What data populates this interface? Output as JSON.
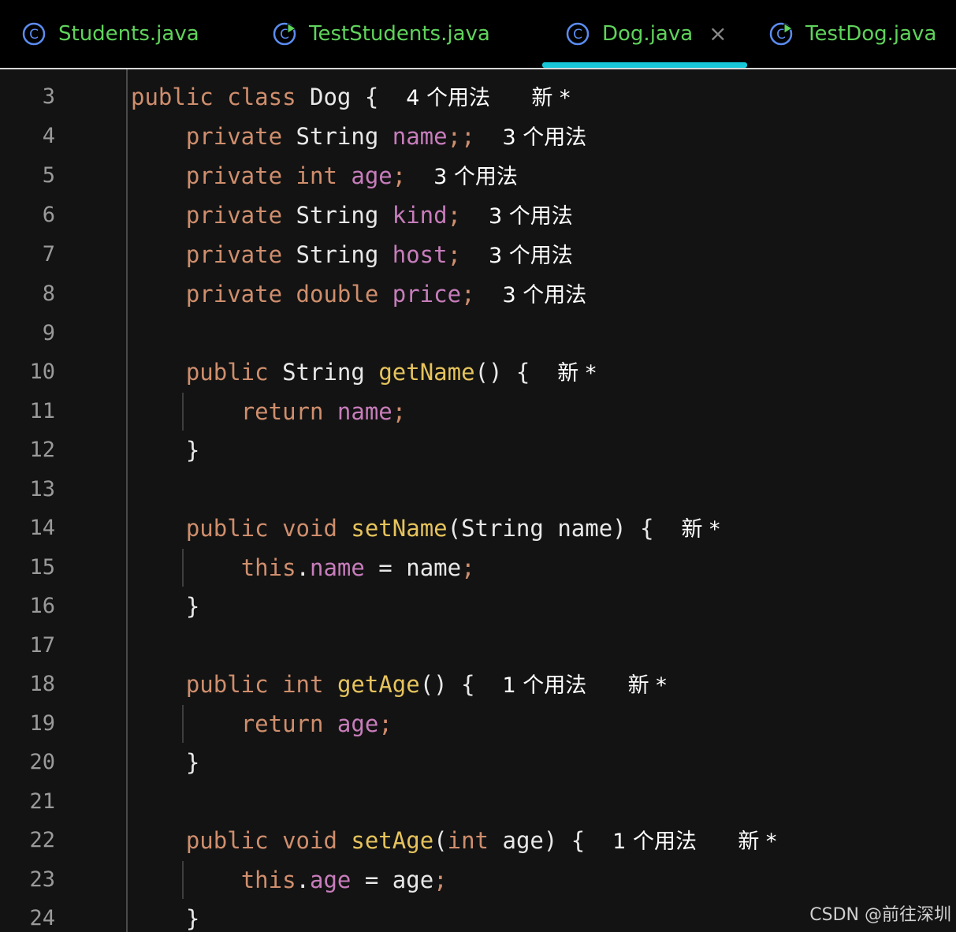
{
  "tabs": [
    {
      "label": "Students.java",
      "icon": "class-icon",
      "active": false
    },
    {
      "label": "TestStudents.java",
      "icon": "runnable-class-icon",
      "active": false
    },
    {
      "label": "Dog.java",
      "icon": "class-icon",
      "active": true,
      "close": "×"
    },
    {
      "label": "TestDog.java",
      "icon": "runnable-class-icon",
      "active": false
    }
  ],
  "colors": {
    "keyword": "#cf8e6d",
    "field": "#c77dbb",
    "method": "#e6c35c",
    "tab_text": "#5fd35b",
    "active_tab_underline": "#17c7d8"
  },
  "editor": {
    "line_numbers": [
      "3",
      "4",
      "5",
      "6",
      "7",
      "8",
      "9",
      "10",
      "11",
      "12",
      "13",
      "14",
      "15",
      "16",
      "17",
      "18",
      "19",
      "20",
      "21",
      "22",
      "23",
      "24"
    ],
    "tokens": {
      "public": "public",
      "private": "private",
      "class": "class",
      "int": "int",
      "double": "double",
      "void": "void",
      "return": "return",
      "this": "this",
      "String": "String",
      "Dog": "Dog",
      "name": "name",
      "age": "age",
      "kind": "kind",
      "host": "host",
      "price": "price",
      "getName": "getName",
      "setName": "setName",
      "getAge": "getAge",
      "setAge": "setAge"
    },
    "hints": {
      "usages_4": "4 个用法",
      "usages_3": "3 个用法",
      "usages_1": "1 个用法",
      "new": "新 *"
    }
  },
  "watermark": "CSDN @前往深圳"
}
